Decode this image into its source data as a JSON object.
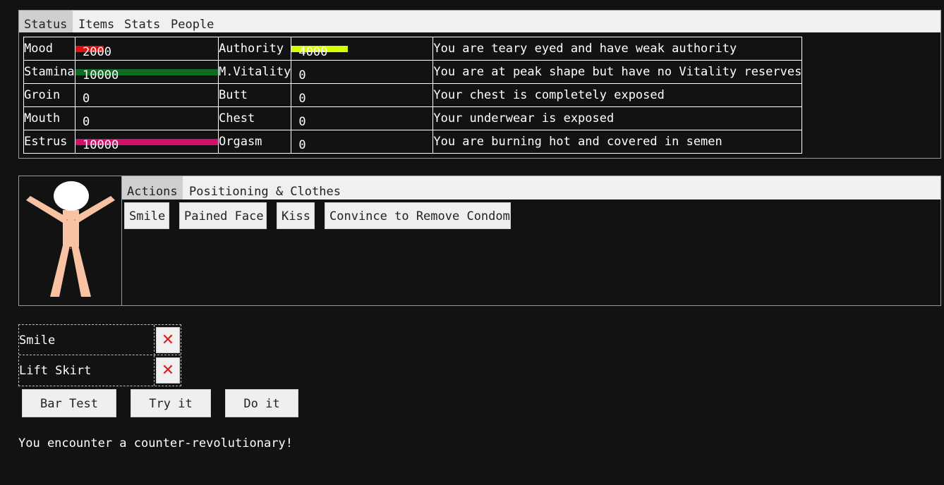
{
  "status_tabs": [
    "Status",
    "Items",
    "Stats",
    "People"
  ],
  "stats": [
    {
      "label": "Mood",
      "value": "2000",
      "fill": 0.2,
      "color": "#e01010",
      "label2": "Authority",
      "value2": "4000",
      "fill2": 0.4,
      "color2": "#d4ff00",
      "desc": "You are teary eyed and have weak authority"
    },
    {
      "label": "Stamina",
      "value": "10000",
      "fill": 1.0,
      "color": "#0f6b23",
      "label2": "M.Vitality",
      "value2": "0",
      "fill2": 0,
      "color2": "#0f6b23",
      "desc": "You are at peak shape but have no Vitality reserves"
    },
    {
      "label": "Groin",
      "value": "0",
      "fill": 0,
      "color": "#e01010",
      "label2": "Butt",
      "value2": "0",
      "fill2": 0,
      "color2": "#e01010",
      "desc": "Your chest is completely exposed"
    },
    {
      "label": "Mouth",
      "value": "0",
      "fill": 0,
      "color": "#e01010",
      "label2": "Chest",
      "value2": "0",
      "fill2": 0,
      "color2": "#e01010",
      "desc": "Your underwear is exposed"
    },
    {
      "label": "Estrus",
      "value": "10000",
      "fill": 1.0,
      "color": "#d0106a",
      "label2": "Orgasm",
      "value2": "0",
      "fill2": 0,
      "color2": "#d0106a",
      "desc": "You are burning hot and covered in semen"
    }
  ],
  "action_tabs": [
    "Actions",
    "Positioning & Clothes"
  ],
  "actions": [
    "Smile",
    "Pained Face",
    "Kiss",
    "Convince to Remove Condom"
  ],
  "queue": [
    "Smile",
    "Lift Skirt"
  ],
  "queue_remove_icon": "✕",
  "buttons": {
    "bar_test": "Bar Test",
    "try_it": "Try it",
    "do_it": "Do it"
  },
  "message": "You encounter a counter-revolutionary!",
  "colors": {
    "background": "#121212",
    "skin": "#f9c3a3"
  }
}
